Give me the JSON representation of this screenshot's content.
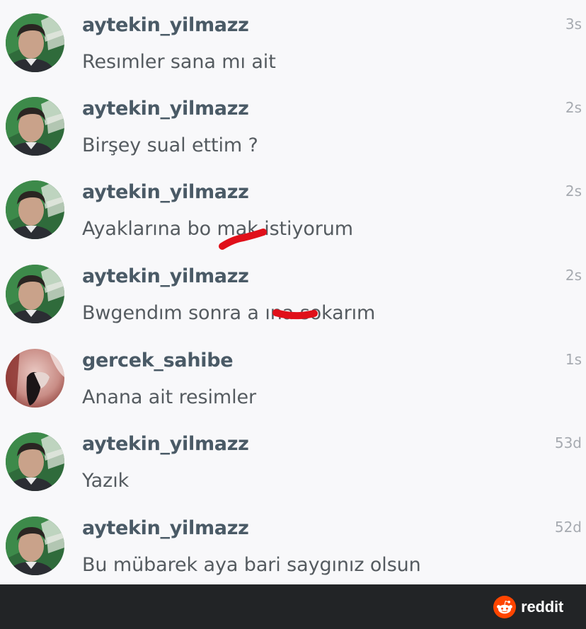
{
  "colors": {
    "redaction": "#e0101a",
    "reddit_brand": "#ff4500",
    "footer_bg": "#222426"
  },
  "comments": [
    {
      "username": "aytekin_yilmazz",
      "text": "Resımler sana mı ait",
      "time": "3s",
      "avatar": "man-avatar"
    },
    {
      "username": "aytekin_yilmazz",
      "text": "Birşey sual ettim ?",
      "time": "2s",
      "avatar": "man-avatar"
    },
    {
      "username": "aytekin_yilmazz",
      "text": "Ayaklarına bo      mak istiyorum",
      "time": "2s",
      "avatar": "man-avatar"
    },
    {
      "username": "aytekin_yilmazz",
      "text": "Bwgendım sonra a       ına sokarım",
      "time": "2s",
      "avatar": "man-avatar"
    },
    {
      "username": "gercek_sahibe",
      "text": "Anana ait resimler",
      "time": "1s",
      "avatar": "woman-avatar"
    },
    {
      "username": "aytekin_yilmazz",
      "text": "Yazık",
      "time": "53d",
      "avatar": "man-avatar"
    },
    {
      "username": "aytekin_yilmazz",
      "text": "Bu mübarek aya bari saygınız olsun",
      "time": "52d",
      "avatar": "man-avatar"
    }
  ],
  "watermark": {
    "brand": "reddit",
    "icon": "reddit-alien-icon"
  }
}
